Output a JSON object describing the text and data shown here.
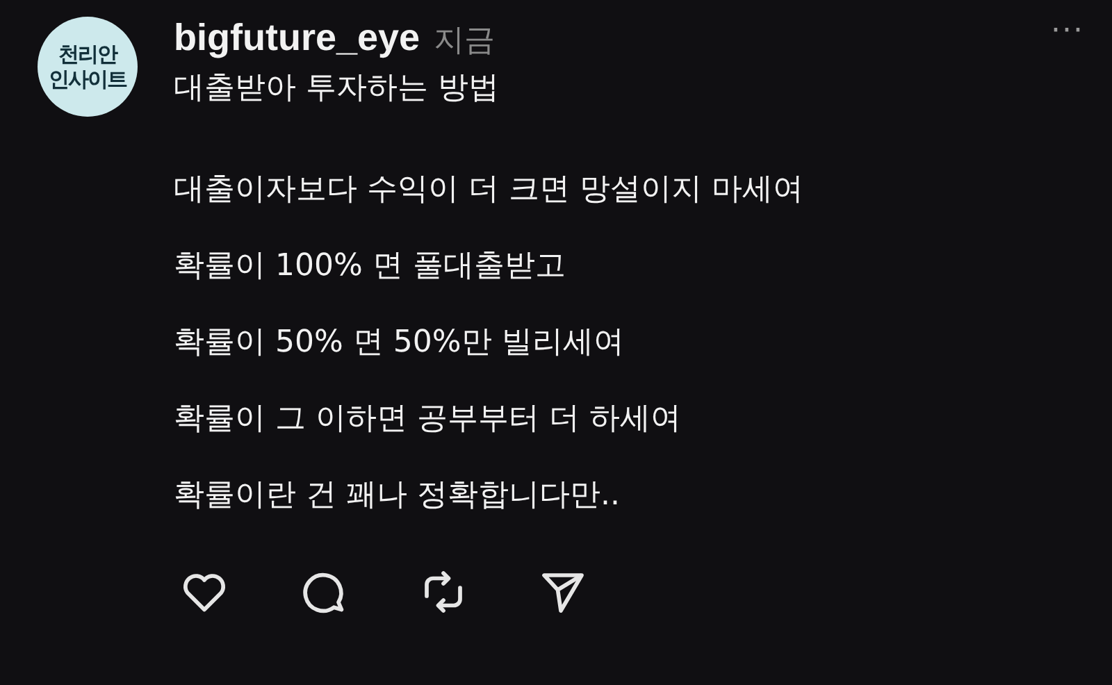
{
  "avatar": {
    "lines": [
      "천리안",
      "인사이트"
    ]
  },
  "username": "bigfuture_eye",
  "time": "지금",
  "more": "···",
  "title": "대출받아 투자하는 방법",
  "lines": [
    "대출이자보다 수익이 더 크면 망설이지 마세여",
    "확률이 100% 면 풀대출받고",
    "확률이 50% 면 50%만 빌리세여",
    "확률이 그 이하면 공부부터 더 하세여",
    "확률이란 건 꽤나 정확합니다만.."
  ],
  "actions": [
    {
      "kind": "like"
    },
    {
      "kind": "reply"
    },
    {
      "kind": "repost"
    },
    {
      "kind": "share"
    }
  ]
}
